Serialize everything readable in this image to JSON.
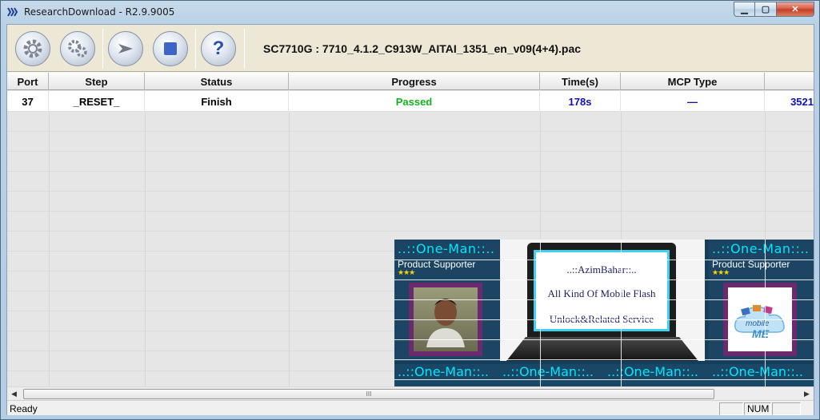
{
  "window": {
    "title": "ResearchDownload - R2.9.9005"
  },
  "window_buttons": {
    "minimize": "▁",
    "maximize": "▢",
    "close": "✕"
  },
  "toolbar": {
    "buttons": [
      {
        "name": "load-packet-button",
        "icon": "gear-icon"
      },
      {
        "name": "settings-button",
        "icon": "gears-icon"
      },
      {
        "name": "start-download-button",
        "icon": "play-arrow-icon"
      },
      {
        "name": "stop-download-button",
        "icon": "stop-icon"
      },
      {
        "name": "help-button",
        "icon": "question-icon",
        "glyph": "?"
      }
    ],
    "pac_file": "SC7710G : 7710_4.1.2_C913W_AITAI_1351_en_v09(4+4).pac"
  },
  "table": {
    "columns": [
      "Port",
      "Step",
      "Status",
      "Progress",
      "Time(s)",
      "MCP Type"
    ],
    "rows": [
      {
        "port": "37",
        "step": "_RESET_",
        "status": "Finish",
        "progress": "Passed",
        "time": "178s",
        "mcp_type": "—",
        "extra": "3521"
      }
    ]
  },
  "banner": {
    "headline": "..::One-Man::..",
    "subtitle": "Product Supporter",
    "stars": "★★★",
    "laptop_lines": [
      "..::AzimBahar::..",
      "All Kind Of Mobile Flash",
      "Unlock&Related Service"
    ],
    "logo_text": "mobile",
    "logo_sub": "ME",
    "strip_text": "..::One-Man::.."
  },
  "scrollbar": {
    "left_arrow": "◀",
    "right_arrow": "▶",
    "grip": "III"
  },
  "statusbar": {
    "text": "Ready",
    "num": "NUM"
  },
  "colors": {
    "passed": "#12b41b",
    "time_blue": "#1010b8",
    "banner_cyan": "#00e6ff"
  }
}
